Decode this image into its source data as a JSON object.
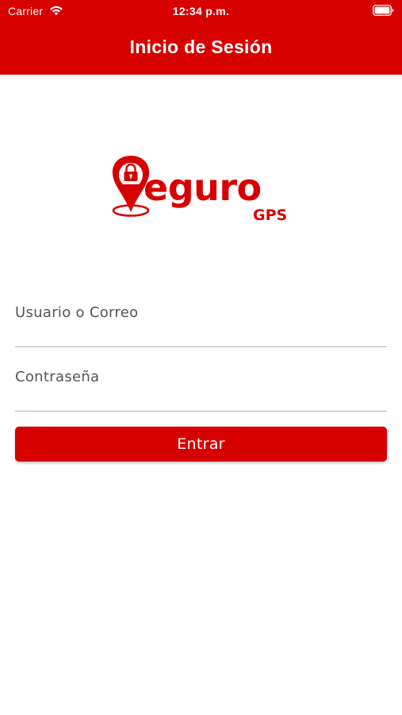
{
  "status_bar": {
    "carrier": "Carrier",
    "time": "12:34 p.m."
  },
  "header": {
    "title": "Inicio de Sesión"
  },
  "logo": {
    "wordmark": "eguro",
    "subtitle": "GPS"
  },
  "form": {
    "username_placeholder": "Usuario o Correo",
    "username_value": "",
    "password_placeholder": "Contraseña",
    "password_value": "",
    "submit_label": "Entrar"
  },
  "colors": {
    "brand_red": "#d70000",
    "underline": "#b5b5b5"
  },
  "icons": {
    "wifi": "wifi-icon",
    "battery": "battery-icon",
    "lock": "lock-icon",
    "location_pin": "location-pin-icon"
  }
}
